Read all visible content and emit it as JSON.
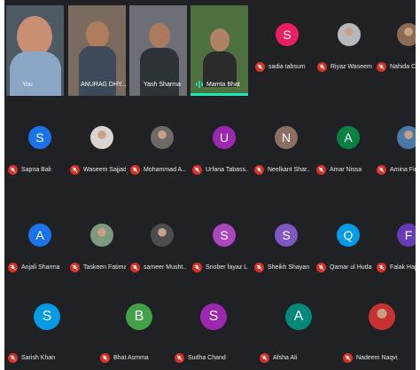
{
  "video_participants": [
    {
      "name": "You"
    },
    {
      "name": "ANURAG DHY..."
    },
    {
      "name": "Yash Sharma"
    },
    {
      "name": "Mamta Bhat"
    }
  ],
  "participants": [
    {
      "name": "sadia tabsum",
      "initial": "S",
      "color": "#e91e63"
    },
    {
      "name": "Riyaz Waseem",
      "initial": "",
      "color": ""
    },
    {
      "name": "Nahida Choud...",
      "initial": "",
      "color": ""
    },
    {
      "name": "Sapna Bali",
      "initial": "S",
      "color": "#1a73e8"
    },
    {
      "name": "Waseem Sajjad",
      "initial": "",
      "color": ""
    },
    {
      "name": "Mohammad A...",
      "initial": "",
      "color": ""
    },
    {
      "name": "Urfana Tabass...",
      "initial": "U",
      "color": "#9c27b0"
    },
    {
      "name": "Neelkant Shar...",
      "initial": "N",
      "color": "#8d6e63"
    },
    {
      "name": "Amar Nissa",
      "initial": "A",
      "color": "#0b8043"
    },
    {
      "name": "Amina Firdous",
      "initial": "",
      "color": ""
    },
    {
      "name": "Anjali Sharma",
      "initial": "A",
      "color": "#1a73e8"
    },
    {
      "name": "Taskeen Fatima",
      "initial": "",
      "color": ""
    },
    {
      "name": "sameer Musht...",
      "initial": "",
      "color": ""
    },
    {
      "name": "Snober fayaz L...",
      "initial": "S",
      "color": "#ab47bc"
    },
    {
      "name": "Sheikh Shayan",
      "initial": "S",
      "color": "#7e57c2"
    },
    {
      "name": "Qamar ul Huda",
      "initial": "Q",
      "color": "#039be5"
    },
    {
      "name": "Falak Hajji",
      "initial": "F",
      "color": "#673ab7"
    },
    {
      "name": "Sarish Khan",
      "initial": "S",
      "color": "#039be5"
    },
    {
      "name": "Bhat Asmma",
      "initial": "B",
      "color": "#43a047"
    },
    {
      "name": "Sudha Chand",
      "initial": "S",
      "color": "#9c27b0"
    },
    {
      "name": "Afsha Ali",
      "initial": "A",
      "color": "#00897b"
    },
    {
      "name": "Nadeem Naqvi",
      "initial": "",
      "color": ""
    }
  ],
  "colors": {
    "background": "#202124",
    "muted": "#d93025",
    "speaking": "#1de9b6"
  }
}
